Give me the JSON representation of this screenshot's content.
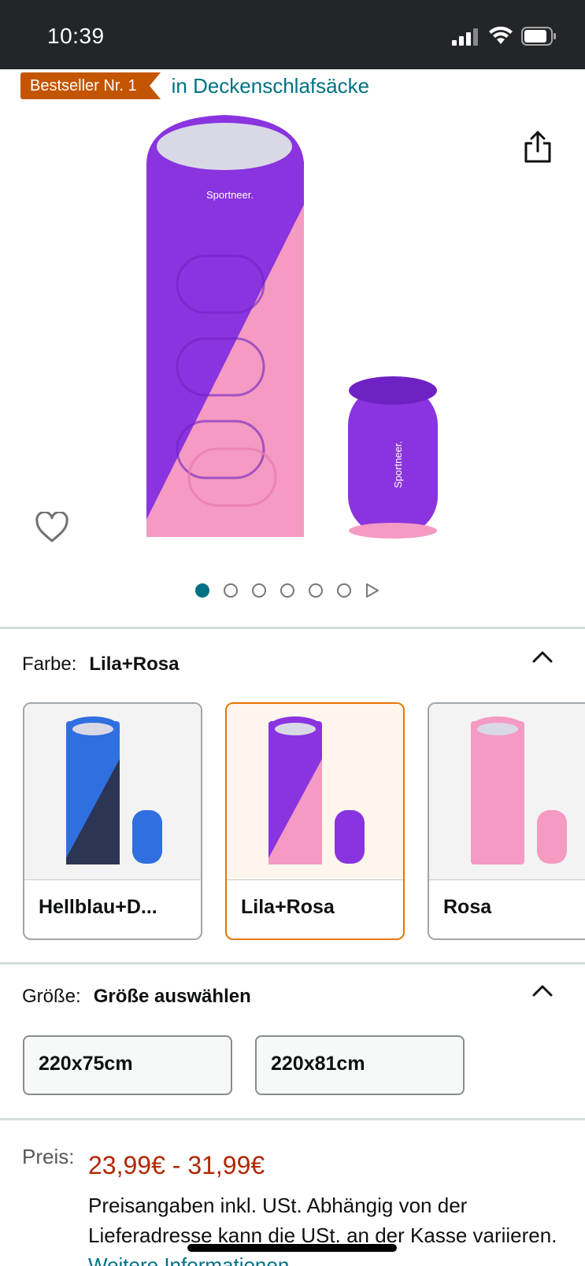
{
  "status_bar": {
    "time": "10:39"
  },
  "bestseller": {
    "badge": "Bestseller Nr. 1",
    "category": "in Deckenschlafsäcke"
  },
  "carousel": {
    "total_dots": 6,
    "active_index": 0
  },
  "color": {
    "label": "Farbe:",
    "selected": "Lila+Rosa",
    "options": [
      {
        "name": "Hellblau+D...",
        "colors": {
          "a": "#2f6fe0",
          "b": "#2c3553"
        }
      },
      {
        "name": "Lila+Rosa",
        "colors": {
          "a": "#8a2be2",
          "b": "#f48fb8"
        }
      },
      {
        "name": "Rosa",
        "colors": {
          "a": "#f48fb8",
          "b": "#f7a8c9"
        }
      }
    ]
  },
  "size": {
    "label": "Größe:",
    "selected": "Größe auswählen",
    "options": [
      "220x75cm",
      "220x81cm"
    ]
  },
  "price": {
    "label": "Preis:",
    "range": "23,99€ - 31,99€",
    "note": "Preisangaben inkl. USt. Abhängig von der Lieferadresse kann die USt. an der Kasse variieren.",
    "more_link": "Weitere Informationen"
  },
  "colors": {
    "link": "#007185",
    "price": "#b12704",
    "badge": "#c45500",
    "selected_border": "#e77600"
  }
}
